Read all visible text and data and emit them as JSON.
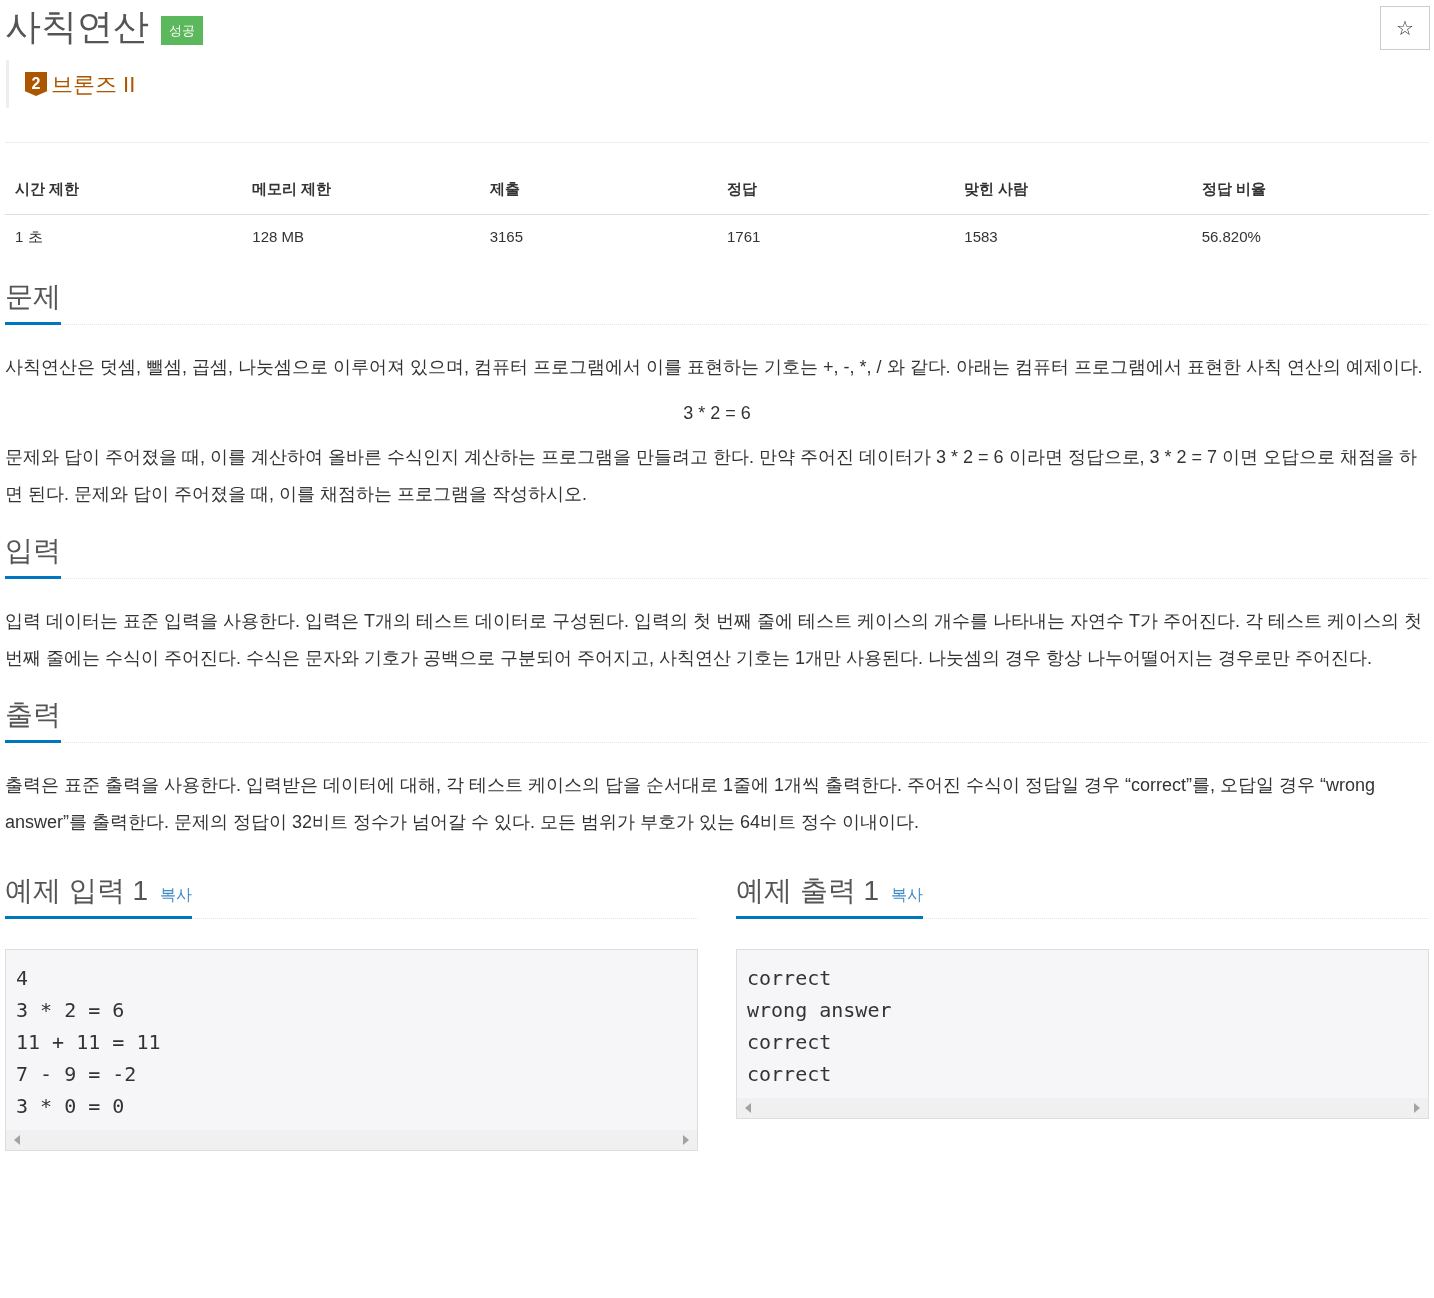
{
  "title": "사칙연산",
  "result_badge": "성공",
  "star_button": "☆",
  "tier": {
    "number": "2",
    "label": "브론즈 II"
  },
  "info_table": {
    "columns": [
      "시간 제한",
      "메모리 제한",
      "제출",
      "정답",
      "맞힌 사람",
      "정답 비율"
    ],
    "rows": [
      [
        "1 초",
        "128 MB",
        "3165",
        "1761",
        "1583",
        "56.820%"
      ]
    ]
  },
  "sections": [
    {
      "heading": "문제",
      "paragraphs": [
        {
          "kind": "text",
          "text": "사칙연산은 덧셈, 뺄셈, 곱셈, 나눗셈으로 이루어져 있으며, 컴퓨터 프로그램에서 이를 표현하는 기호는 +, -, *, / 와 같다. 아래는 컴퓨터 프로그램에서 표현한 사칙 연산의 예제이다."
        },
        {
          "kind": "center",
          "text": "3 * 2 = 6"
        },
        {
          "kind": "text",
          "text": "문제와 답이 주어졌을 때, 이를 계산하여 올바른 수식인지 계산하는 프로그램을 만들려고 한다. 만약 주어진 데이터가 3 * 2 = 6 이라면 정답으로, 3 * 2 = 7 이면 오답으로 채점을 하면 된다. 문제와 답이 주어졌을 때, 이를 채점하는 프로그램을 작성하시오."
        }
      ]
    },
    {
      "heading": "입력",
      "paragraphs": [
        {
          "kind": "text",
          "text": "입력 데이터는 표준 입력을 사용한다. 입력은 T개의 테스트 데이터로 구성된다. 입력의 첫 번째 줄에 테스트 케이스의 개수를 나타내는 자연수 T가 주어진다. 각 테스트 케이스의 첫 번째 줄에는 수식이 주어진다. 수식은 문자와 기호가 공백으로 구분되어 주어지고, 사칙연산 기호는 1개만 사용된다. 나눗셈의 경우 항상 나누어떨어지는 경우로만 주어진다."
        }
      ]
    },
    {
      "heading": "출력",
      "paragraphs": [
        {
          "kind": "text",
          "text": "출력은 표준 출력을 사용한다. 입력받은 데이터에 대해, 각 테스트 케이스의 답을 순서대로 1줄에 1개씩 출력한다. 주어진 수식이 정답일 경우 “correct”를, 오답일 경우 “wrong answer”를 출력한다. 문제의 정답이 32비트 정수가 넘어갈 수 있다. 모든 범위가 부호가 있는 64비트 정수 이내이다."
        }
      ]
    }
  ],
  "samples": [
    {
      "heading": "예제 입력 1",
      "copy": "복사",
      "lines": [
        "4",
        "3 * 2 = 6",
        "11 + 11 = 11",
        "7 - 9 = -2",
        "3 * 0 = 0"
      ]
    },
    {
      "heading": "예제 출력 1",
      "copy": "복사",
      "lines": [
        "correct",
        "wrong answer",
        "correct",
        "correct"
      ]
    }
  ]
}
